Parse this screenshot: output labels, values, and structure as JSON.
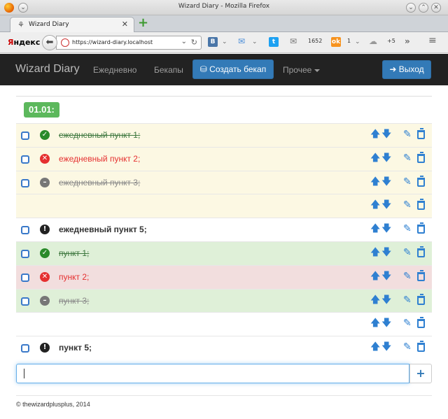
{
  "window": {
    "title": "Wizard Diary - Mozilla Firefox"
  },
  "browser": {
    "tab_title": "Wizard Diary",
    "url": "https://wizard-diary.localhost",
    "yandex_label_red": "Я",
    "yandex_label_rest": "ндекс",
    "badge_mail": "1652",
    "badge_ok": "1",
    "badge_weather": "+5"
  },
  "app": {
    "brand": "Wizard Diary",
    "nav": [
      "Ежедневно",
      "Бекапы"
    ],
    "create_backup_label": "Создать бекап",
    "more_label": "Прочее",
    "logout_label": "Выход"
  },
  "day": {
    "date_label": "01.01:"
  },
  "items": [
    {
      "text": "ежедневный пункт 1;",
      "status": "done",
      "row": "warn"
    },
    {
      "text": "ежедневный пункт 2;",
      "status": "fail",
      "row": "warn"
    },
    {
      "text": "ежедневный пункт 3;",
      "status": "cancel",
      "row": "warn"
    },
    {
      "text": "",
      "status": "none",
      "row": "warn"
    },
    {
      "text": "ежедневный пункт 5;",
      "status": "todo",
      "row": "plain"
    },
    {
      "text": "пункт 1;",
      "status": "done",
      "row": "ok"
    },
    {
      "text": "пункт 2;",
      "status": "fail",
      "row": "bad"
    },
    {
      "text": "пункт 3;",
      "status": "cancel",
      "row": "ok"
    },
    {
      "text": "",
      "status": "none",
      "row": "plain"
    },
    {
      "text": "пункт 5;",
      "status": "todo",
      "row": "plain"
    }
  ],
  "new_item": {
    "value": ""
  },
  "footer": {
    "text": "© thewizardplusplus, 2014"
  },
  "colors": {
    "primary": "#337ab7",
    "success": "#5cb85c",
    "navbar": "#222222",
    "warning_row": "#fcf8e3",
    "success_row": "#dff0d8",
    "danger_row": "#f2dede"
  },
  "icons": {
    "done": "ok-sign-icon",
    "fail": "remove-sign-icon",
    "cancel": "minus-sign-icon",
    "todo": "exclamation-sign-icon"
  }
}
